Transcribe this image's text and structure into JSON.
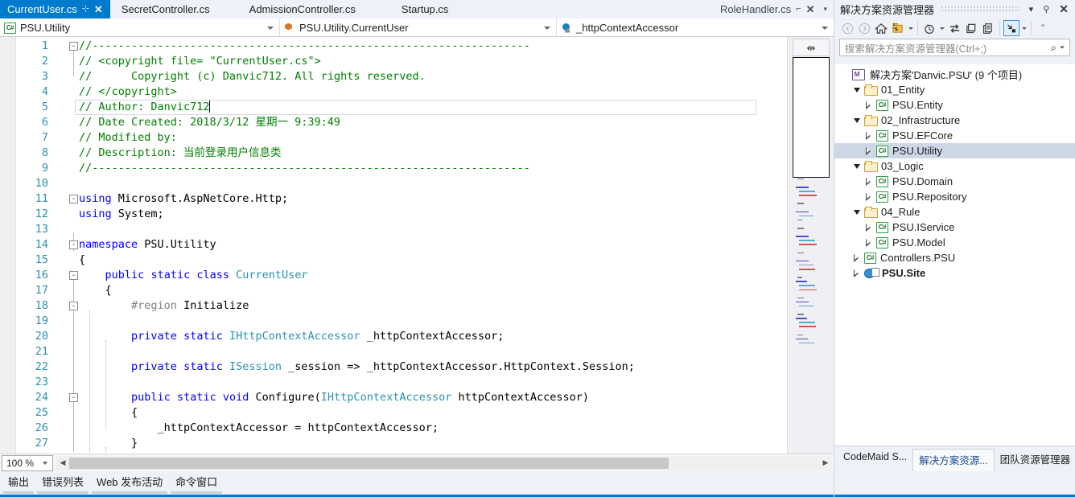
{
  "tabs": [
    {
      "label": "CurrentUser.cs",
      "active": true,
      "pin": "⊹",
      "close": "✕"
    },
    {
      "label": "SecretController.cs",
      "active": false
    },
    {
      "label": "AdmissionController.cs",
      "active": false
    },
    {
      "label": "Startup.cs",
      "active": false
    },
    {
      "label": "RoleHandler.cs",
      "active": false,
      "pin": "⌐",
      "close": "✕"
    }
  ],
  "tab_overflow_caret": "▾",
  "navbar": {
    "project": "PSU.Utility",
    "type": "PSU.Utility.CurrentUser",
    "member": "_httpContextAccessor"
  },
  "editor": {
    "current_line": 5,
    "lines": [
      {
        "n": 1,
        "fold": "-",
        "tokens": [
          {
            "t": "//-------------------------------------------------------------------",
            "c": "c-com"
          }
        ]
      },
      {
        "n": 2,
        "tokens": [
          {
            "t": "// <copyright file= \"CurrentUser.cs\">",
            "c": "c-com"
          }
        ]
      },
      {
        "n": 3,
        "tokens": [
          {
            "t": "//      Copyright (c) Danvic712. All rights reserved.",
            "c": "c-com"
          }
        ]
      },
      {
        "n": 4,
        "tokens": [
          {
            "t": "// </copyright>",
            "c": "c-com"
          }
        ]
      },
      {
        "n": 5,
        "tokens": [
          {
            "t": "// Author: Danvic712",
            "c": "c-com"
          }
        ],
        "caret": true
      },
      {
        "n": 6,
        "tokens": [
          {
            "t": "// Date Created: 2018/3/12 星期一 9:39:49",
            "c": "c-com"
          }
        ]
      },
      {
        "n": 7,
        "tokens": [
          {
            "t": "// Modified by:",
            "c": "c-com"
          }
        ]
      },
      {
        "n": 8,
        "tokens": [
          {
            "t": "// Description: 当前登录用户信息类",
            "c": "c-com"
          }
        ]
      },
      {
        "n": 9,
        "tokens": [
          {
            "t": "//-------------------------------------------------------------------",
            "c": "c-com"
          }
        ]
      },
      {
        "n": 10,
        "tokens": []
      },
      {
        "n": 11,
        "fold": "-",
        "tokens": [
          {
            "t": "using",
            "c": "c-key"
          },
          {
            "t": " Microsoft.AspNetCore.Http;",
            "c": "c-txt"
          }
        ]
      },
      {
        "n": 12,
        "tokens": [
          {
            "t": "using",
            "c": "c-key"
          },
          {
            "t": " System;",
            "c": "c-txt"
          }
        ]
      },
      {
        "n": 13,
        "tokens": []
      },
      {
        "n": 14,
        "fold": "-",
        "tokens": [
          {
            "t": "namespace",
            "c": "c-key"
          },
          {
            "t": " PSU.Utility",
            "c": "c-txt"
          }
        ]
      },
      {
        "n": 15,
        "tokens": [
          {
            "t": "{",
            "c": "c-txt"
          }
        ]
      },
      {
        "n": 16,
        "fold": "-",
        "tokens": [
          {
            "t": "    ",
            "c": "c-txt"
          },
          {
            "t": "public",
            "c": "c-key"
          },
          {
            "t": " ",
            "c": "c-txt"
          },
          {
            "t": "static",
            "c": "c-key"
          },
          {
            "t": " ",
            "c": "c-txt"
          },
          {
            "t": "class",
            "c": "c-key"
          },
          {
            "t": " ",
            "c": "c-txt"
          },
          {
            "t": "CurrentUser",
            "c": "c-typ"
          }
        ]
      },
      {
        "n": 17,
        "tokens": [
          {
            "t": "    {",
            "c": "c-txt"
          }
        ]
      },
      {
        "n": 18,
        "fold": "-",
        "tokens": [
          {
            "t": "        ",
            "c": "c-txt"
          },
          {
            "t": "#region",
            "c": "c-pre"
          },
          {
            "t": " Initialize",
            "c": "c-txt"
          }
        ]
      },
      {
        "n": 19,
        "tokens": []
      },
      {
        "n": 20,
        "tokens": [
          {
            "t": "        ",
            "c": "c-txt"
          },
          {
            "t": "private",
            "c": "c-key"
          },
          {
            "t": " ",
            "c": "c-txt"
          },
          {
            "t": "static",
            "c": "c-key"
          },
          {
            "t": " ",
            "c": "c-txt"
          },
          {
            "t": "IHttpContextAccessor",
            "c": "c-typ"
          },
          {
            "t": " _httpContextAccessor;",
            "c": "c-txt"
          }
        ]
      },
      {
        "n": 21,
        "tokens": []
      },
      {
        "n": 22,
        "tokens": [
          {
            "t": "        ",
            "c": "c-txt"
          },
          {
            "t": "private",
            "c": "c-key"
          },
          {
            "t": " ",
            "c": "c-txt"
          },
          {
            "t": "static",
            "c": "c-key"
          },
          {
            "t": " ",
            "c": "c-txt"
          },
          {
            "t": "ISession",
            "c": "c-typ"
          },
          {
            "t": " _session => _httpContextAccessor.HttpContext.Session;",
            "c": "c-txt"
          }
        ]
      },
      {
        "n": 23,
        "tokens": []
      },
      {
        "n": 24,
        "fold": "-",
        "tokens": [
          {
            "t": "        ",
            "c": "c-txt"
          },
          {
            "t": "public",
            "c": "c-key"
          },
          {
            "t": " ",
            "c": "c-txt"
          },
          {
            "t": "static",
            "c": "c-key"
          },
          {
            "t": " ",
            "c": "c-txt"
          },
          {
            "t": "void",
            "c": "c-key"
          },
          {
            "t": " Configure(",
            "c": "c-txt"
          },
          {
            "t": "IHttpContextAccessor",
            "c": "c-typ"
          },
          {
            "t": " httpContextAccessor)",
            "c": "c-txt"
          }
        ]
      },
      {
        "n": 25,
        "tokens": [
          {
            "t": "        {",
            "c": "c-txt"
          }
        ]
      },
      {
        "n": 26,
        "tokens": [
          {
            "t": "            _httpContextAccessor = httpContextAccessor;",
            "c": "c-txt"
          }
        ]
      },
      {
        "n": 27,
        "tokens": [
          {
            "t": "        }",
            "c": "c-txt"
          }
        ]
      }
    ]
  },
  "minimap": {
    "splitter_glyph": "⇹"
  },
  "statusbar": {
    "zoom": "100 %",
    "left_arrow": "◀",
    "right_arrow": "▶"
  },
  "dock_tabs": [
    {
      "label": "输出"
    },
    {
      "label": "错误列表"
    },
    {
      "label": "Web 发布活动"
    },
    {
      "label": "命令窗口"
    }
  ],
  "solution_explorer": {
    "title": "解决方案资源管理器",
    "title_caret": "▾",
    "pin": "⚲",
    "close": "✕",
    "toolbar": [
      {
        "name": "back-arrow-icon",
        "glyph": "back"
      },
      {
        "name": "forward-arrow-icon",
        "glyph": "forward"
      },
      {
        "name": "home-icon",
        "glyph": "home"
      },
      {
        "name": "new-solution-view-icon",
        "glyph": "newview"
      },
      {
        "name": "pending-changes-icon",
        "glyph": "clock"
      },
      {
        "name": "sync-with-active-document-icon",
        "glyph": "sync"
      },
      {
        "name": "refresh-icon",
        "glyph": "refresh"
      },
      {
        "name": "show-all-files-icon",
        "glyph": "allfiles"
      },
      {
        "name": "collapse-expand-icon",
        "glyph": "collapse"
      },
      {
        "name": "overflow-icon",
        "glyph": "overflow"
      }
    ],
    "search_placeholder": "搜索解决方案资源管理器(Ctrl+;)",
    "search_value": "",
    "search_icon": "search-icon",
    "tree": [
      {
        "label": "解决方案'Danvic.PSU' (9 个项目)",
        "icon": "solution",
        "indent": 0,
        "arrow": "none",
        "selected": false,
        "bold": false
      },
      {
        "label": "01_Entity",
        "icon": "folder",
        "indent": 1,
        "arrow": "open",
        "selected": false,
        "bold": false
      },
      {
        "label": "PSU.Entity",
        "icon": "csproj",
        "indent": 2,
        "arrow": "closed",
        "selected": false,
        "bold": false
      },
      {
        "label": "02_Infrastructure",
        "icon": "folder",
        "indent": 1,
        "arrow": "open",
        "selected": false,
        "bold": false
      },
      {
        "label": "PSU.EFCore",
        "icon": "csproj",
        "indent": 2,
        "arrow": "closed",
        "selected": false,
        "bold": false
      },
      {
        "label": "PSU.Utility",
        "icon": "csproj",
        "indent": 2,
        "arrow": "closed",
        "selected": true,
        "bold": false
      },
      {
        "label": "03_Logic",
        "icon": "folder",
        "indent": 1,
        "arrow": "open",
        "selected": false,
        "bold": false
      },
      {
        "label": "PSU.Domain",
        "icon": "csproj",
        "indent": 2,
        "arrow": "closed",
        "selected": false,
        "bold": false
      },
      {
        "label": "PSU.Repository",
        "icon": "csproj",
        "indent": 2,
        "arrow": "closed",
        "selected": false,
        "bold": false
      },
      {
        "label": "04_Rule",
        "icon": "folder",
        "indent": 1,
        "arrow": "open",
        "selected": false,
        "bold": false
      },
      {
        "label": "PSU.IService",
        "icon": "csproj",
        "indent": 2,
        "arrow": "closed",
        "selected": false,
        "bold": false
      },
      {
        "label": "PSU.Model",
        "icon": "csproj",
        "indent": 2,
        "arrow": "closed",
        "selected": false,
        "bold": false
      },
      {
        "label": "Controllers.PSU",
        "icon": "csproj",
        "indent": 1,
        "arrow": "closed",
        "selected": false,
        "bold": false
      },
      {
        "label": "PSU.Site",
        "icon": "web",
        "indent": 1,
        "arrow": "closed",
        "selected": false,
        "bold": true
      }
    ],
    "bottom_tabs": [
      {
        "label": "CodeMaid S...",
        "active": false
      },
      {
        "label": "解决方案资源...",
        "active": true
      },
      {
        "label": "团队资源管理器",
        "active": false
      }
    ]
  },
  "colors": {
    "accent": "#007acc",
    "selection": "#cdd7e6",
    "comment": "#008000",
    "keyword": "#0000ff",
    "type": "#2b91af"
  }
}
